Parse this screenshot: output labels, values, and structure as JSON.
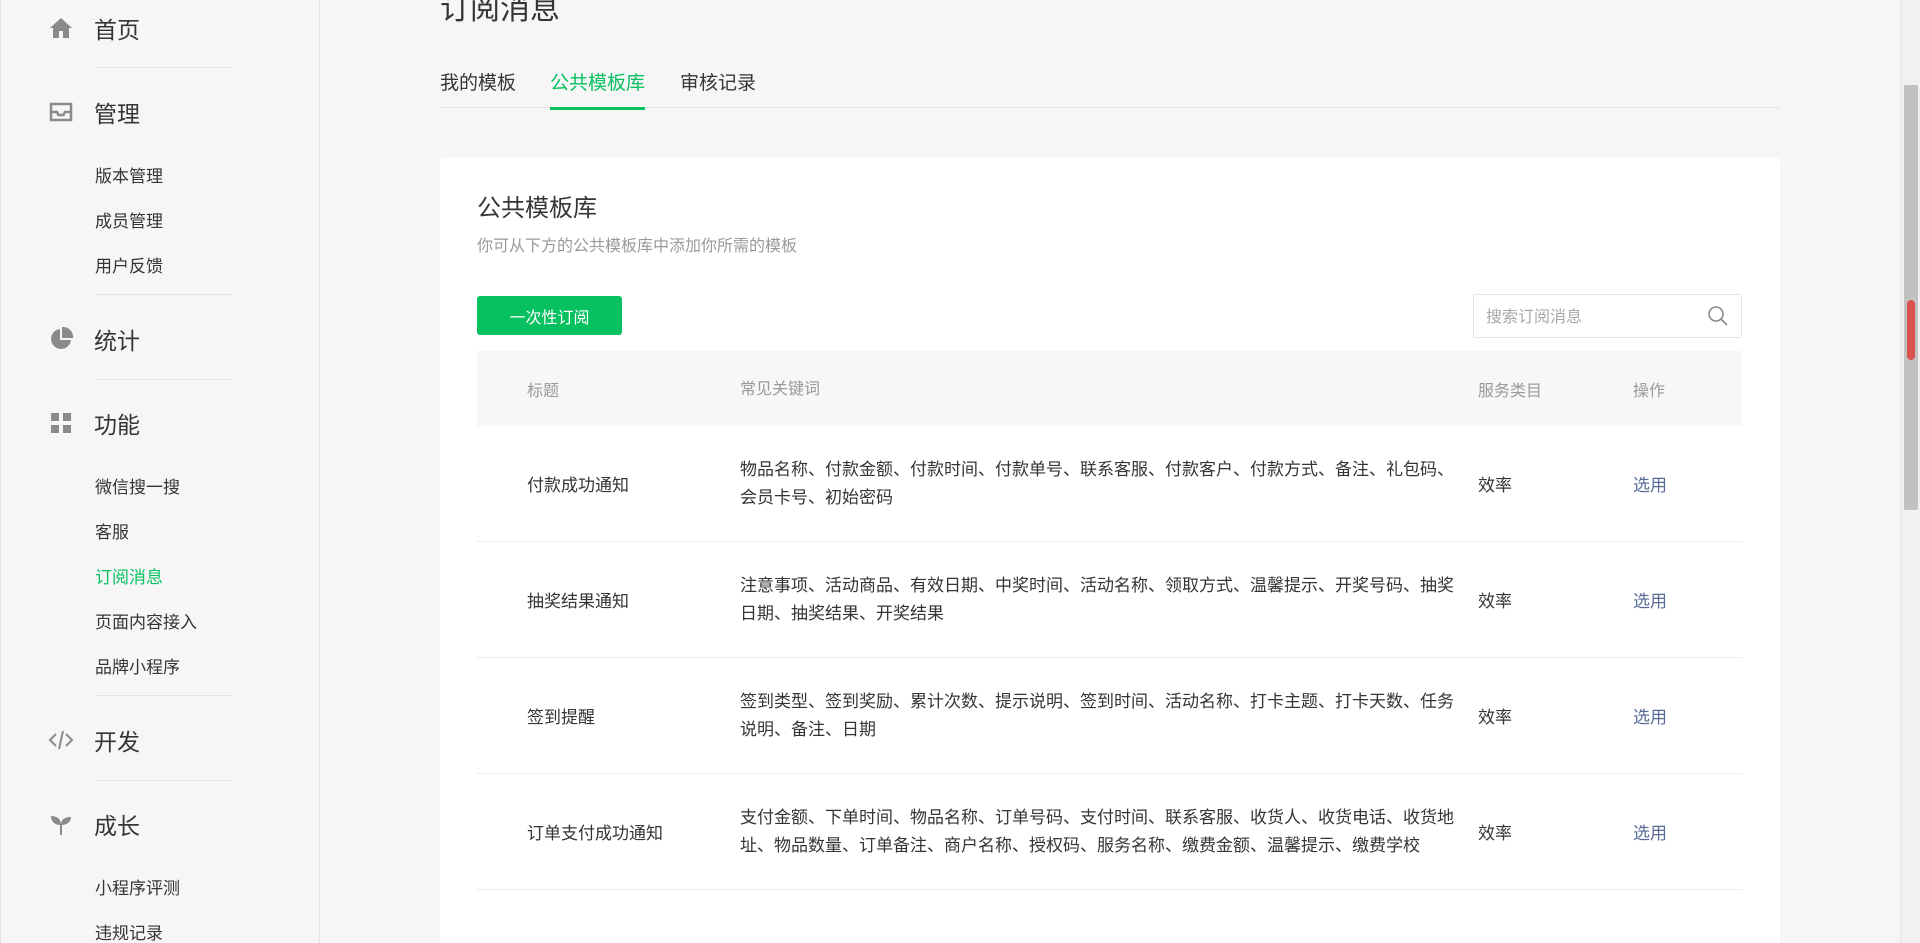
{
  "sidebar": {
    "categories": [
      {
        "label": "首页",
        "icon": "home-icon"
      },
      {
        "label": "管理",
        "icon": "inbox-icon"
      },
      {
        "label": "统计",
        "icon": "pie-chart-icon"
      },
      {
        "label": "功能",
        "icon": "grid-icon"
      },
      {
        "label": "开发",
        "icon": "code-icon"
      },
      {
        "label": "成长",
        "icon": "sprout-icon"
      }
    ],
    "management_items": [
      "版本管理",
      "成员管理",
      "用户反馈"
    ],
    "feature_items": [
      "微信搜一搜",
      "客服",
      "订阅消息",
      "页面内容接入",
      "品牌小程序"
    ],
    "growth_items": [
      "小程序评测",
      "违规记录"
    ],
    "active_item": "订阅消息"
  },
  "page": {
    "title": "订阅消息",
    "tabs": [
      "我的模板",
      "公共模板库",
      "审核记录"
    ],
    "active_tab": "公共模板库"
  },
  "card": {
    "title": "公共模板库",
    "description": "你可从下方的公共模板库中添加你所需的模板",
    "primary_button": "一次性订阅",
    "search_placeholder": "搜索订阅消息"
  },
  "table": {
    "headers": [
      "标题",
      "常见关键词",
      "服务类目",
      "操作"
    ],
    "rows": [
      {
        "title": "付款成功通知",
        "keywords": "物品名称、付款金额、付款时间、付款单号、联系客服、付款客户、付款方式、备注、礼包码、会员卡号、初始密码",
        "service": "效率",
        "action": "选用"
      },
      {
        "title": "抽奖结果通知",
        "keywords": "注意事项、活动商品、有效日期、中奖时间、活动名称、领取方式、温馨提示、开奖号码、抽奖日期、抽奖结果、开奖结果",
        "service": "效率",
        "action": "选用"
      },
      {
        "title": "签到提醒",
        "keywords": "签到类型、签到奖励、累计次数、提示说明、签到时间、活动名称、打卡主题、打卡天数、任务说明、备注、日期",
        "service": "效率",
        "action": "选用"
      },
      {
        "title": "订单支付成功通知",
        "keywords": "支付金额、下单时间、物品名称、订单号码、支付时间、联系客服、收货人、收货电话、收货地址、物品数量、订单备注、商户名称、授权码、服务名称、缴费金额、温馨提示、缴费学校",
        "service": "效率",
        "action": "选用"
      }
    ]
  },
  "colors": {
    "accent": "#07c160",
    "link": "#576b95",
    "muted": "#9a9a9a"
  }
}
